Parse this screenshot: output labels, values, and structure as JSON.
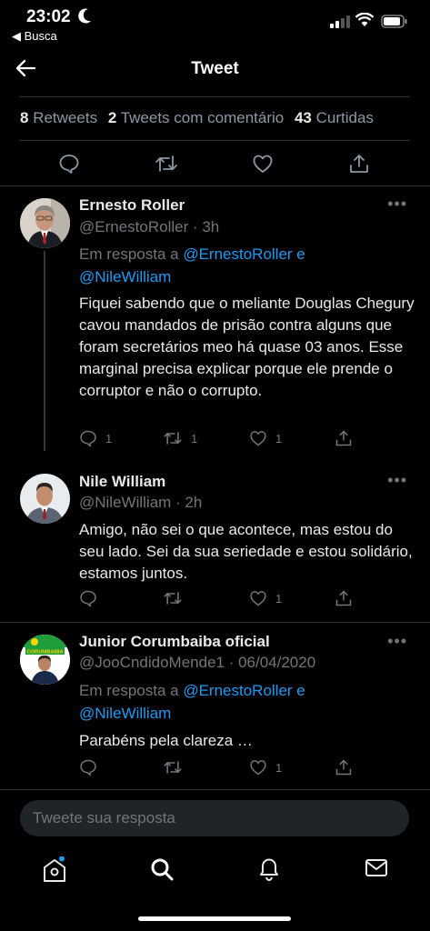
{
  "status_bar": {
    "time": "23:02",
    "back_app": "◀ Busca"
  },
  "header": {
    "title": "Tweet"
  },
  "stats": {
    "retweets_count": "8",
    "retweets_label": "Retweets",
    "quotes_count": "2",
    "quotes_label": "Tweets com comentário",
    "likes_count": "43",
    "likes_label": "Curtidas"
  },
  "replies": [
    {
      "name": "Ernesto Roller",
      "handle": "@ErnestoRoller · 3h",
      "reply_prefix": "Em resposta a ",
      "mention1": "@ErnestoRoller",
      "and": " e",
      "mention2": "@NileWilliam",
      "text": "Fiquei sabendo que o meliante Douglas Chegury cavou mandados de prisão contra alguns que foram  secretários meo há quase 03 anos. Esse marginal precisa explicar porque ele prende o corruptor e não o corrupto.",
      "reply_count": "1",
      "retweet_count": "1",
      "like_count": "1"
    },
    {
      "name": "Nile William",
      "handle": "@NileWilliam · 2h",
      "text": "Amigo, não sei o que acontece, mas estou do seu lado. Sei da sua seriedade e estou solidário, estamos juntos.",
      "reply_count": "",
      "retweet_count": "",
      "like_count": "1"
    },
    {
      "name": "Junior Corumbaiba oficial",
      "handle": "@JooCndidoMende1 · 06/04/2020",
      "reply_prefix": "Em resposta a ",
      "mention1": "@ErnestoRoller",
      "and": " e",
      "mention2": "@NileWilliam",
      "text": "Parabéns pela clareza …",
      "reply_count": "",
      "retweet_count": "",
      "like_count": "1",
      "avatar_text": "CORUMBAIBA"
    }
  ],
  "composer": {
    "placeholder": "Tweete sua resposta"
  },
  "colors": {
    "accent": "#1d9bf0",
    "muted": "#71767b",
    "background": "#000000"
  }
}
